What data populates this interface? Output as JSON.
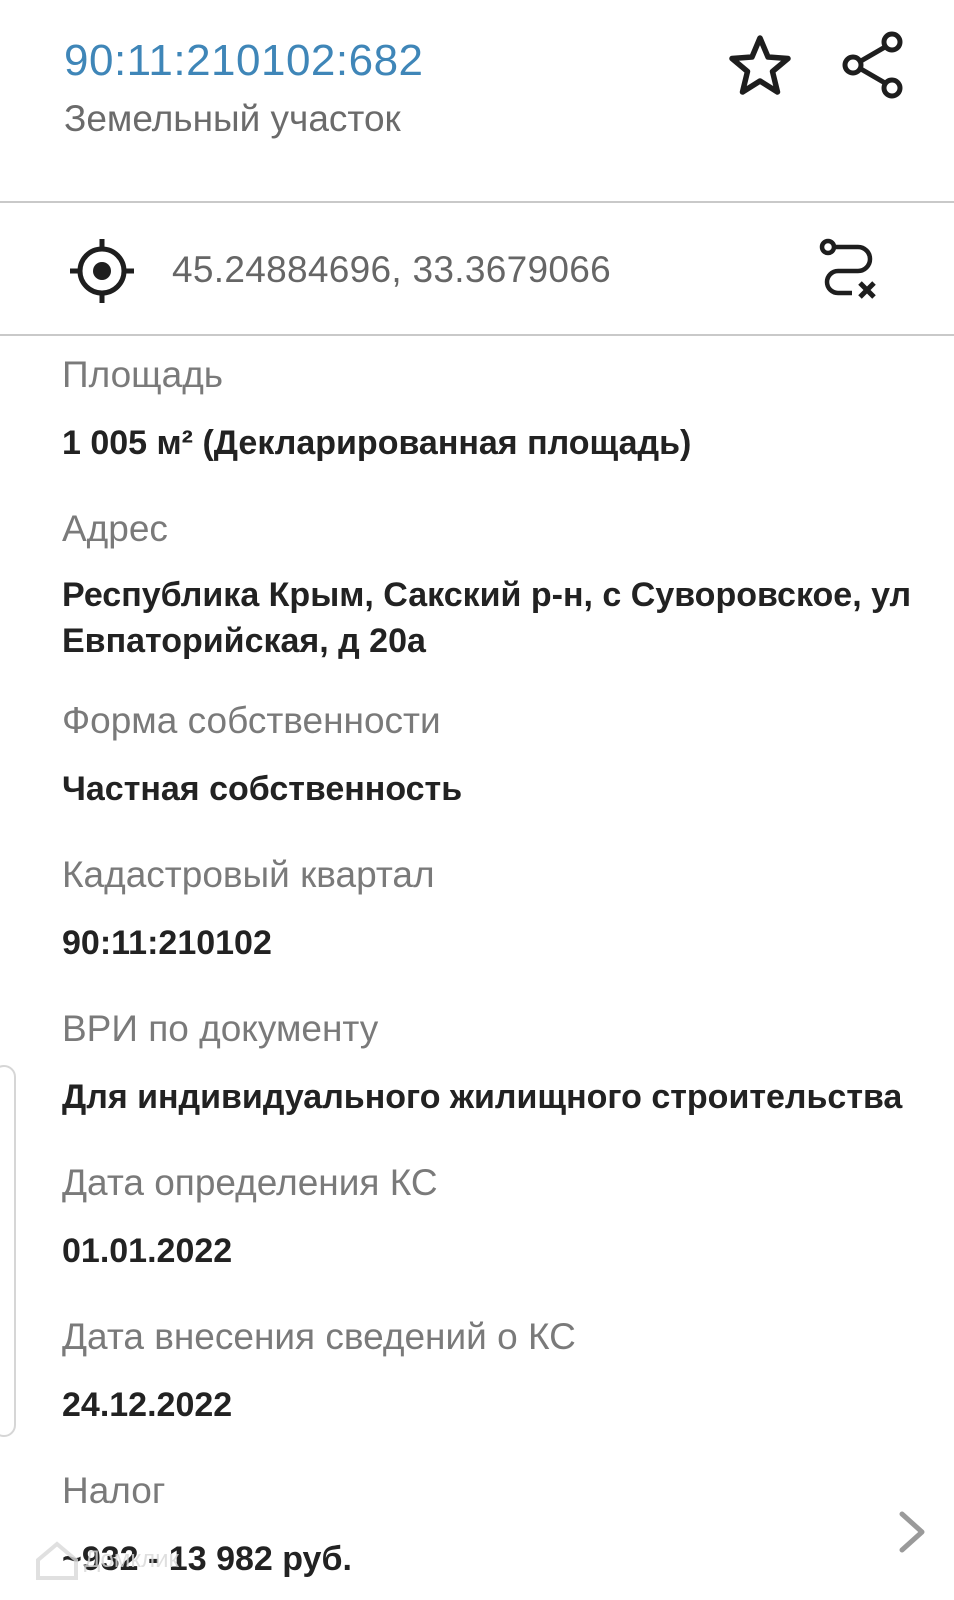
{
  "header": {
    "cadastral_number": "90:11:210102:682",
    "object_type": "Земельный участок",
    "favorite_icon": "star-outline-icon",
    "share_icon": "share-icon"
  },
  "coords": {
    "icon": "target-icon",
    "text": "45.24884696, 33.3679066",
    "route_icon": "route-clear-icon"
  },
  "fields": [
    {
      "label": "Площадь",
      "value": "1 005 м² (Декларированная площадь)"
    },
    {
      "label": "Адрес",
      "value": "Республика Крым, Сакский р-н, с Суворовское, ул Евпаторийская, д 20а"
    },
    {
      "label": "Форма собственности",
      "value": "Частная собственность"
    },
    {
      "label": "Кадастровый квартал",
      "value": "90:11:210102"
    },
    {
      "label": "ВРИ по документу",
      "value": "Для индивидуального жилищного строительства"
    },
    {
      "label": "Дата определения КС",
      "value": "01.01.2022"
    },
    {
      "label": "Дата внесения сведений о КС",
      "value": "24.12.2022"
    },
    {
      "label": "Налог",
      "value": "~932 - 13 982 руб."
    }
  ],
  "tax_chevron_icon": "chevron-right-icon",
  "watermark": {
    "text": "Домклик"
  },
  "colors": {
    "accent": "#3f86b8",
    "label": "#7a7a7a",
    "value": "#222222",
    "divider": "#c9c9c9"
  }
}
